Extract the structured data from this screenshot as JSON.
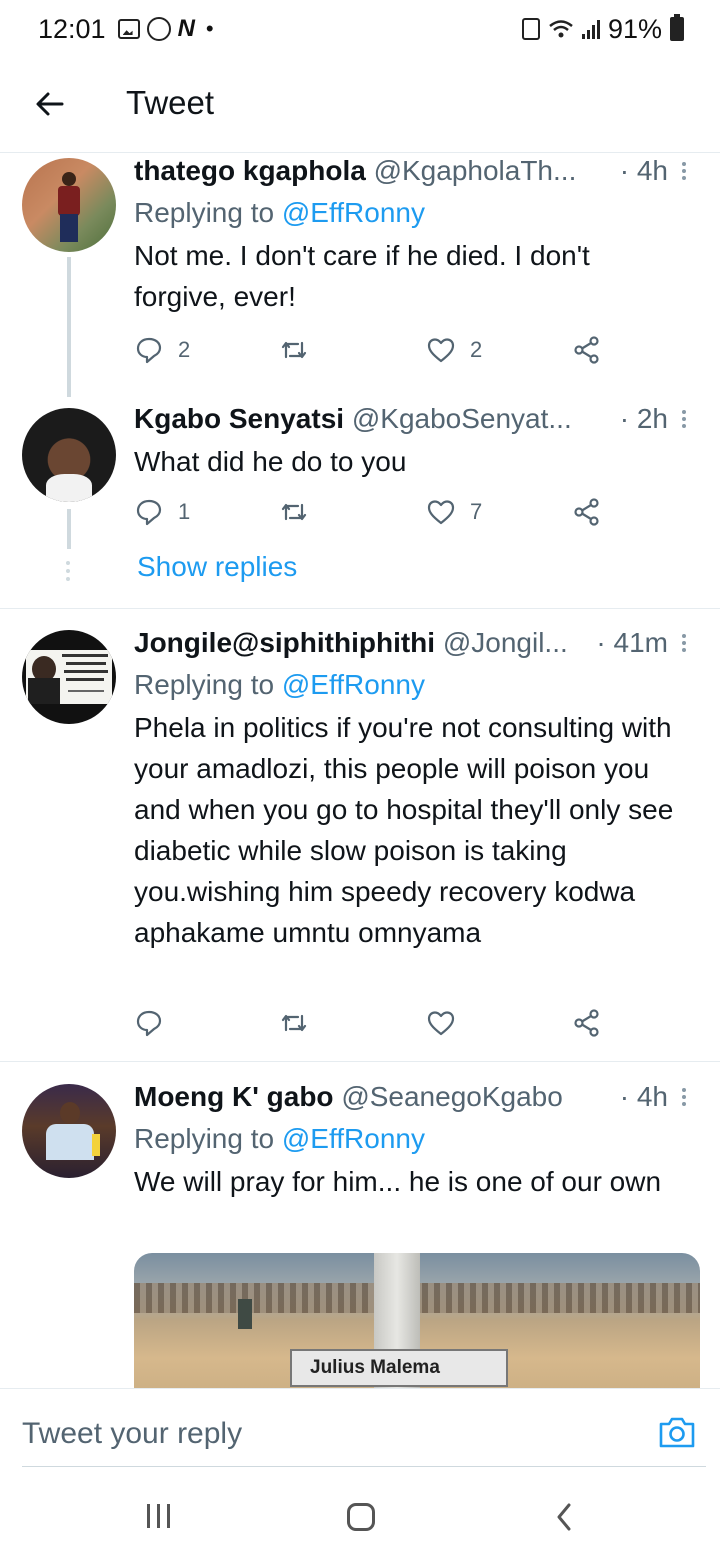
{
  "status_bar": {
    "time": "12:01",
    "battery": "91%"
  },
  "header": {
    "title": "Tweet"
  },
  "tweets": [
    {
      "name": "thatego kgaphola",
      "handle": "@KgapholaTh...",
      "time": "· 4h",
      "replying_prefix": "Replying to",
      "replying_to": "@EffRonny",
      "text": "Not me. I don't care if he died. I don't forgive, ever!",
      "replies": "2",
      "likes": "2"
    },
    {
      "name": "Kgabo Senyatsi",
      "handle": "@KgaboSenyat...",
      "time": "· 2h",
      "text": "What did he do to you",
      "replies": "1",
      "likes": "7"
    },
    {
      "name": "Jongile@siphithiphithi",
      "handle": "@Jongil...",
      "time": "· 41m",
      "replying_prefix": "Replying to",
      "replying_to": "@EffRonny",
      "text": "Phela in politics if you're not consulting with your amadlozi, this people will poison you and when you go to hospital they'll only see diabetic while slow poison is taking you.wishing him speedy recovery kodwa aphakame umntu omnyama"
    },
    {
      "name": "Moeng K' gabo",
      "handle": "@SeanegoKgabo",
      "time": "· 4h",
      "replying_prefix": "Replying to",
      "replying_to": "@EffRonny",
      "text": "We will pray for him... he is one of our own",
      "media_caption": "Julius Malema"
    }
  ],
  "show_replies": "Show replies",
  "reply_bar": {
    "placeholder": "Tweet your reply"
  },
  "colors": {
    "accent": "#1d9bf0",
    "secondary_text": "#536471",
    "divider": "#e6ecf0"
  }
}
